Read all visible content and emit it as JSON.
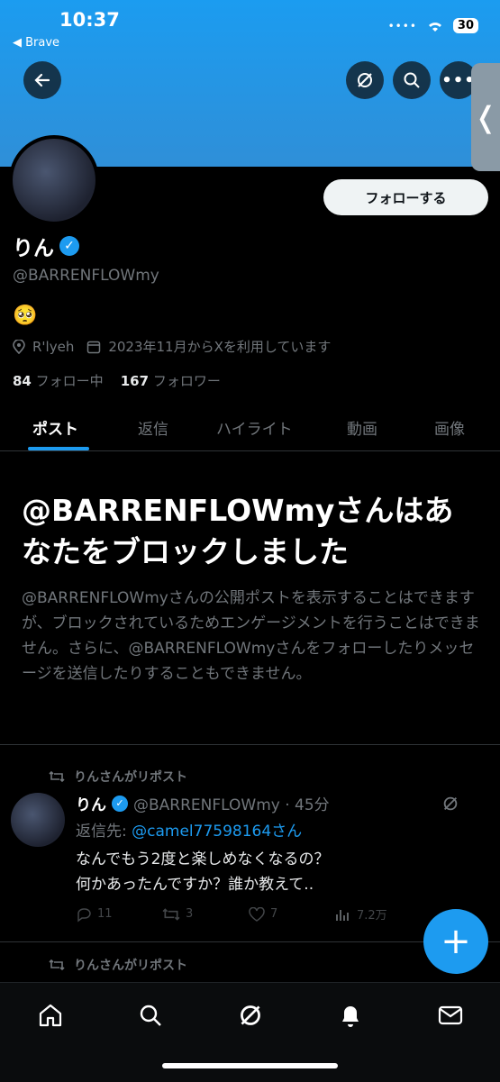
{
  "status": {
    "time": "10:37",
    "back_app": "◀ Brave",
    "battery": "30"
  },
  "profile": {
    "follow_label": "フォローする",
    "name": "りん",
    "handle": "@BARRENFLOWmy",
    "bio_emoji": "🥺",
    "location": "R'lyeh",
    "joined": "2023年11月からXを利用しています",
    "following_count": "84",
    "following_label": "フォロー中",
    "followers_count": "167",
    "followers_label": "フォロワー"
  },
  "tabs": [
    "ポスト",
    "返信",
    "ハイライト",
    "動画",
    "画像"
  ],
  "blocked": {
    "title": "@BARRENFLOWmyさんはあなたをブロックしました",
    "description": "@BARRENFLOWmyさんの公開ポストを表示することはできますが、ブロックされているためエンゲージメントを行うことはできません。さらに、@BARRENFLOWmyさんをフォローしたりメッセージを送信したりすることもできません。"
  },
  "post": {
    "repost_label": "りんさんがリポスト",
    "name": "りん",
    "handle_time": "@BARRENFLOWmy · 45分",
    "reply_prefix": "返信先:",
    "reply_to": "@camel77598164さん",
    "body": "なんでもう2度と楽しめなくなるの？\n何かあったんですか？誰か教えて..",
    "replies": "11",
    "reposts": "3",
    "likes": "7",
    "views": "7.2万"
  },
  "next_repost_label": "りんさんがリポスト",
  "colors": {
    "accent": "#1d9bf0",
    "banner": "#2f8fd8"
  },
  "icons": [
    "back-arrow-icon",
    "grok-icon",
    "search-icon",
    "more-icon",
    "verified-icon",
    "location-icon",
    "calendar-icon",
    "repost-icon",
    "reply-icon",
    "like-icon",
    "views-icon",
    "home-icon",
    "bell-icon",
    "mail-icon",
    "plus-icon"
  ]
}
